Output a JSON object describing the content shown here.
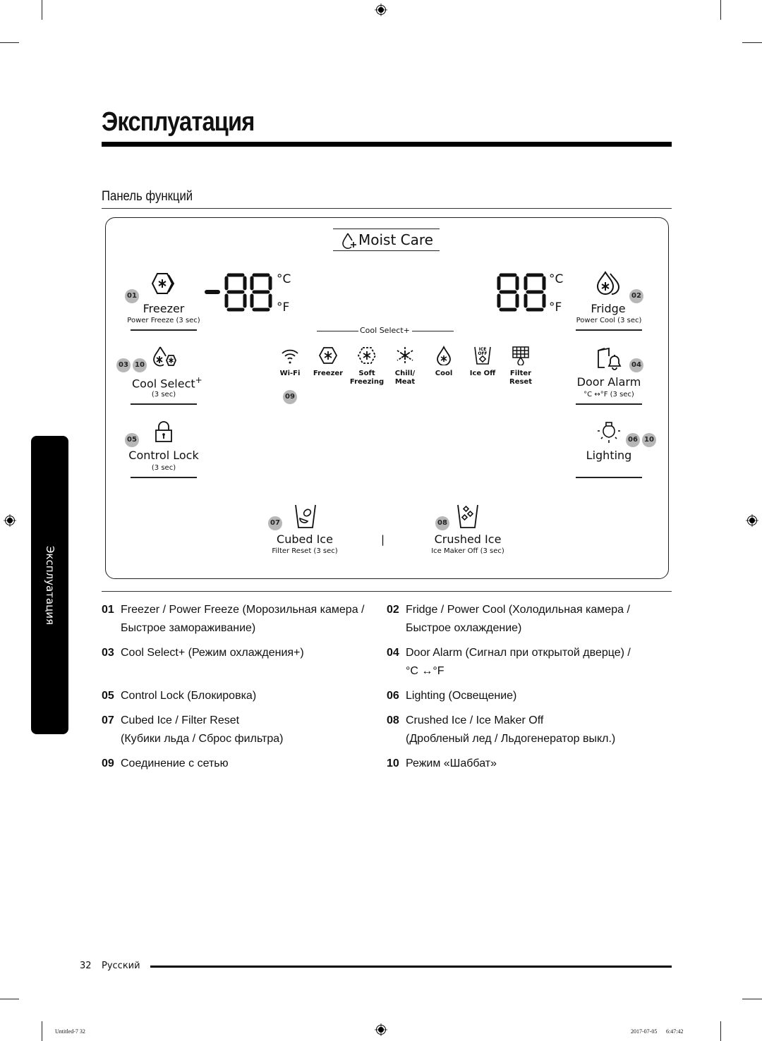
{
  "page": {
    "title": "Эксплуатация",
    "section_title": "Панель функций",
    "side_tab": "Эксплуатация",
    "page_number": "32",
    "language": "Русский",
    "print_file": "Untitled-7   32",
    "print_date": "2017-07-05",
    "print_time": "6:47:42"
  },
  "panel": {
    "moist_care": "Moist Care",
    "freezer": {
      "badge": "01",
      "label": "Freezer",
      "sub": "Power Freeze (3 sec)",
      "icon": "freezer-hexagon-icon"
    },
    "freezer_display": {
      "value": "-88",
      "unit_c": "°C",
      "unit_f": "°F"
    },
    "fridge_display": {
      "value": "88",
      "unit_c": "°C",
      "unit_f": "°F"
    },
    "fridge": {
      "badge": "02",
      "label": "Fridge",
      "sub": "Power Cool (3 sec)",
      "icon": "fridge-drops-icon"
    },
    "cool_select_header": "Cool Select+",
    "cool_select": {
      "badges": [
        "03",
        "10"
      ],
      "label": "Cool Select",
      "sup": "+",
      "sub": "(3 sec)"
    },
    "door_alarm": {
      "badge": "04",
      "label": "Door Alarm",
      "sub": "°C ↔°F (3 sec)"
    },
    "control_lock": {
      "badge": "05",
      "label": "Control Lock",
      "sub": "(3 sec)"
    },
    "lighting": {
      "badges": [
        "06",
        "10"
      ],
      "label": "Lighting"
    },
    "cubed_ice": {
      "badge": "07",
      "label": "Cubed Ice",
      "sub": "Filter Reset (3 sec)"
    },
    "crushed_ice": {
      "badge": "08",
      "label": "Crushed Ice",
      "sub": "Ice Maker Off (3 sec)"
    },
    "separator": "|",
    "status_badge": "09",
    "status_icons": [
      {
        "icon": "wifi-icon",
        "line1": "Wi-Fi",
        "line2": ""
      },
      {
        "icon": "freezer-icon",
        "line1": "Freezer",
        "line2": ""
      },
      {
        "icon": "soft-freezing-icon",
        "line1": "Soft",
        "line2": "Freezing"
      },
      {
        "icon": "chill-meat-icon",
        "line1": "Chill/",
        "line2": "Meat"
      },
      {
        "icon": "cool-icon",
        "line1": "Cool",
        "line2": ""
      },
      {
        "icon": "ice-off-icon",
        "line1": "Ice Off",
        "line2": "",
        "glyph_top": "ICE",
        "glyph_bottom": "OFF"
      },
      {
        "icon": "filter-reset-icon",
        "line1": "Filter",
        "line2": "Reset"
      }
    ]
  },
  "legend": [
    {
      "num": "01",
      "lines": [
        "Freezer / Power Freeze (Морозильная камера /",
        "Быстрое замораживание)"
      ]
    },
    {
      "num": "02",
      "lines": [
        "Fridge / Power Cool (Холодильная камера /",
        "Быстрое охлаждение)"
      ]
    },
    {
      "num": "03",
      "lines": [
        "Cool Select+ (Режим охлаждения+)"
      ]
    },
    {
      "num": "04",
      "lines": [
        "Door Alarm (Сигнал при открытой дверце) /",
        "°C ↔°F"
      ]
    },
    {
      "num": "05",
      "lines": [
        "Control Lock (Блокировка)"
      ]
    },
    {
      "num": "06",
      "lines": [
        "Lighting (Освещение)"
      ]
    },
    {
      "num": "07",
      "lines": [
        "Cubed Ice / Filter Reset",
        "(Кубики льда / Сброс фильтра)"
      ]
    },
    {
      "num": "08",
      "lines": [
        "Crushed Ice / Ice Maker Off",
        "(Дробленый лед / Льдогенератор выкл.)"
      ]
    },
    {
      "num": "09",
      "lines": [
        "Соединение с сетью"
      ]
    },
    {
      "num": "10",
      "lines": [
        "Режим «Шаббат»"
      ]
    }
  ]
}
